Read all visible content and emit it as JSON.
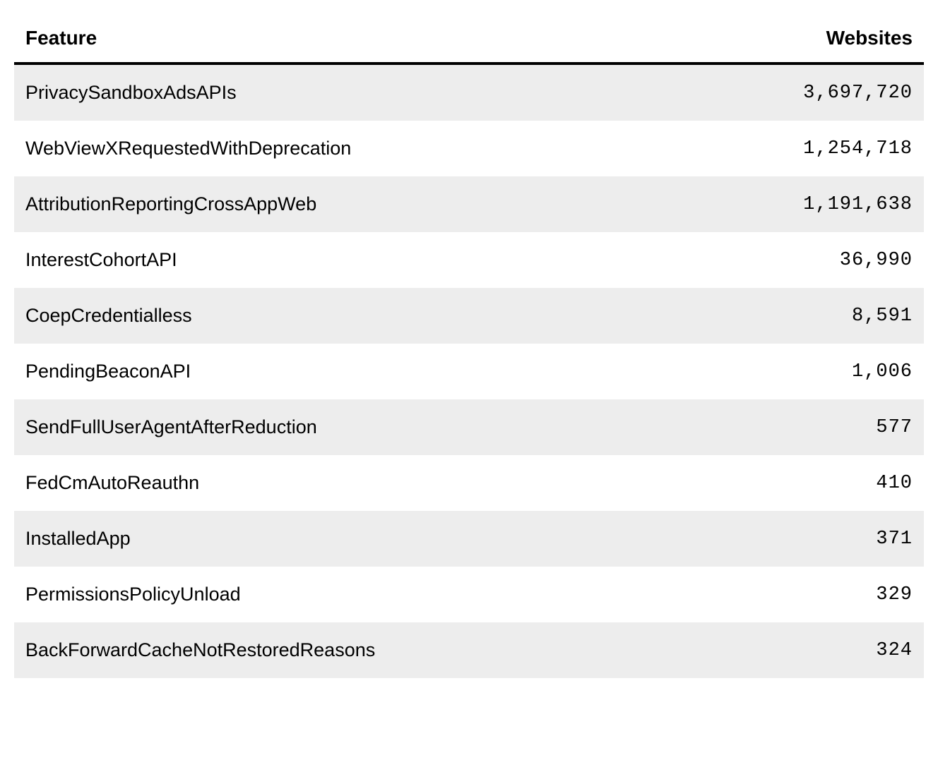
{
  "table": {
    "headers": {
      "feature": "Feature",
      "websites": "Websites"
    },
    "rows": [
      {
        "feature": "PrivacySandboxAdsAPIs",
        "websites": "3,697,720"
      },
      {
        "feature": "WebViewXRequestedWithDeprecation",
        "websites": "1,254,718"
      },
      {
        "feature": "AttributionReportingCrossAppWeb",
        "websites": "1,191,638"
      },
      {
        "feature": "InterestCohortAPI",
        "websites": "36,990"
      },
      {
        "feature": "CoepCredentialless",
        "websites": "8,591"
      },
      {
        "feature": "PendingBeaconAPI",
        "websites": "1,006"
      },
      {
        "feature": "SendFullUserAgentAfterReduction",
        "websites": "577"
      },
      {
        "feature": "FedCmAutoReauthn",
        "websites": "410"
      },
      {
        "feature": "InstalledApp",
        "websites": "371"
      },
      {
        "feature": "PermissionsPolicyUnload",
        "websites": "329"
      },
      {
        "feature": "BackForwardCacheNotRestoredReasons",
        "websites": "324"
      }
    ]
  }
}
